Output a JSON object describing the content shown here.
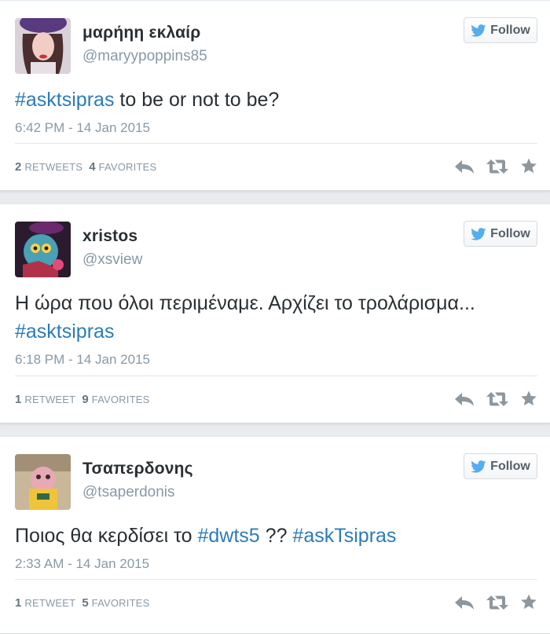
{
  "follow_label": "Follow",
  "tweets": [
    {
      "display_name": "μαρήηη εκλαίρ",
      "handle": "@maryypoppins85",
      "text_parts": [
        "#asktsipras",
        " to be or not to be?"
      ],
      "timestamp": "6:42 PM - 14 Jan 2015",
      "retweets_count": "2",
      "retweets_label": "RETWEETS",
      "favorites_count": "4",
      "favorites_label": "FAVORITES"
    },
    {
      "display_name": "xristos",
      "handle": "@xsview",
      "text_parts": [
        "Η ώρα που όλοι περιμέναμε. Αρχίζει το τρολάρισμα...",
        "#asktsipras"
      ],
      "timestamp": "6:18 PM - 14 Jan 2015",
      "retweets_count": "1",
      "retweets_label": "RETWEET",
      "favorites_count": "9",
      "favorites_label": "FAVORITES"
    },
    {
      "display_name": "Τσαπερδονης",
      "handle": "@tsaperdonis",
      "text_parts": [
        "Ποιος θα κερδίσει το ",
        "#dwts5",
        " ?? ",
        "#askTsipras"
      ],
      "timestamp": "2:33 AM - 14 Jan 2015",
      "retweets_count": "1",
      "retweets_label": "RETWEET",
      "favorites_count": "5",
      "favorites_label": "FAVORITES"
    }
  ],
  "icons": {
    "follow": "twitter-bird-icon",
    "reply": "reply-icon",
    "retweet": "retweet-icon",
    "favorite": "star-icon"
  },
  "colors": {
    "hashtag": "#2b7bb9",
    "twitter_blue": "#55acee",
    "muted": "#8899a6",
    "action_icon": "#8e979e"
  }
}
